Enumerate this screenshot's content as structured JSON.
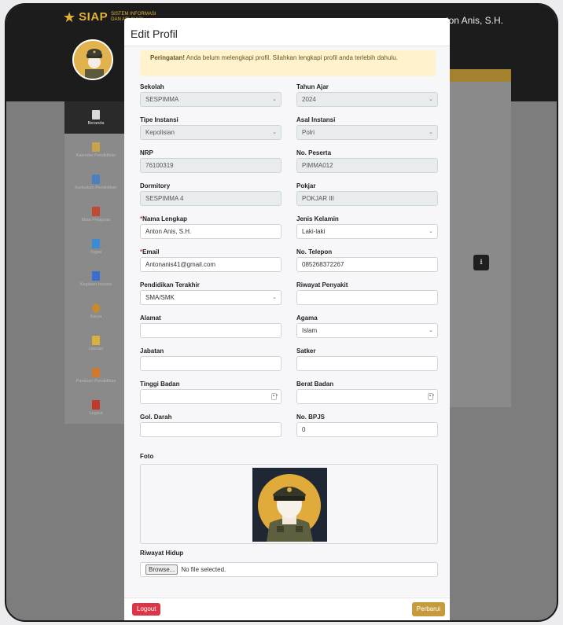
{
  "app": {
    "brand_name": "SIAP",
    "brand_sub": "SISTEM INFORMASI DAN APLIKASI",
    "user_name": "nton Anis, S.H."
  },
  "sidebar": {
    "items": [
      {
        "label": "Beranda",
        "icon": "home-icon",
        "color": "#d9d9d9"
      },
      {
        "label": "Kalender Pendidikan",
        "icon": "calendar-icon",
        "color": "#c9a34a"
      },
      {
        "label": "Kurikulum Pendidikan",
        "icon": "book-icon",
        "color": "#4b7fbf"
      },
      {
        "label": "Mata Pelajaran",
        "icon": "book-red-icon",
        "color": "#c0492f"
      },
      {
        "label": "Tugas",
        "icon": "document-icon",
        "color": "#3a8bd1"
      },
      {
        "label": "Kegiatan Inovasi",
        "icon": "bookmark-icon",
        "color": "#3a6fd1"
      },
      {
        "label": "Karya",
        "icon": "palette-icon",
        "color": "#c98a2e"
      },
      {
        "label": "Literasi",
        "icon": "clipboard-icon",
        "color": "#d9b03a"
      },
      {
        "label": "Panduan Pendidikan",
        "icon": "guide-icon",
        "color": "#d07a2e"
      },
      {
        "label": "Logout",
        "icon": "logout-icon",
        "color": "#c0392b"
      }
    ]
  },
  "modal": {
    "title": "Edit Profil",
    "alert_strong": "Peringatan!",
    "alert_text": " Anda belum melengkapi profil. Silahkan lengkapi profil anda terlebih dahulu.",
    "fields": {
      "sekolah": {
        "label": "Sekolah",
        "value": "SESPIMMA"
      },
      "tahun_ajar": {
        "label": "Tahun Ajar",
        "value": "2024"
      },
      "tipe_instansi": {
        "label": "Tipe Instansi",
        "value": "Kepolisian"
      },
      "asal_instansi": {
        "label": "Asal Instansi",
        "value": "Polri"
      },
      "nrp": {
        "label": "NRP",
        "value": "76100319"
      },
      "no_peserta": {
        "label": "No. Peserta",
        "value": "PIMMA012"
      },
      "dormitory": {
        "label": "Dormitory",
        "value": "SESPIMMA 4"
      },
      "pokjar": {
        "label": "Pokjar",
        "value": "POKJAR III"
      },
      "nama": {
        "label": "Nama Lengkap",
        "required": "*",
        "value": "Anton Anis, S.H."
      },
      "jenis_kelamin": {
        "label": "Jenis Kelamin",
        "value": "Laki-laki"
      },
      "email": {
        "label": "Email",
        "required": "*",
        "value": "Antonanis41@gmail.com"
      },
      "telepon": {
        "label": "No. Telepon",
        "value": "085268372267"
      },
      "pendidikan": {
        "label": "Pendidikan Terakhir",
        "value": "SMA/SMK"
      },
      "riwayat_penyakit": {
        "label": "Riwayat Penyakit",
        "value": ""
      },
      "alamat": {
        "label": "Alamat",
        "value": ""
      },
      "agama": {
        "label": "Agama",
        "value": "Islam"
      },
      "jabatan": {
        "label": "Jabatan",
        "value": ""
      },
      "satker": {
        "label": "Satker",
        "value": ""
      },
      "tinggi_badan": {
        "label": "Tinggi Badan",
        "value": ""
      },
      "berat_badan": {
        "label": "Berat Badan",
        "value": ""
      },
      "gol_darah": {
        "label": "Gol. Darah",
        "value": ""
      },
      "bpjs": {
        "label": "No. BPJS",
        "value": "0"
      }
    },
    "foto_label": "Foto",
    "riwayat_hidup_label": "Riwayat Hidup",
    "browse_label": "Browse...",
    "file_status": "No file selected.",
    "logout_label": "Logout",
    "perbarui_label": "Perbarui"
  }
}
